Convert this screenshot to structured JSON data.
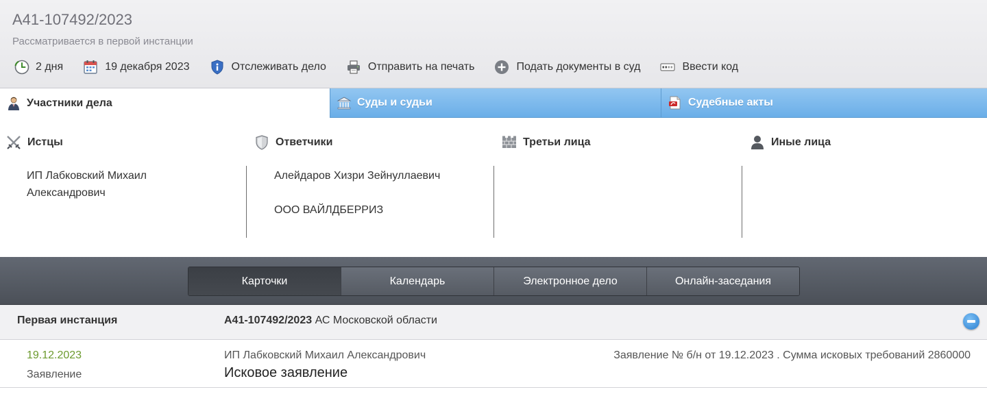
{
  "header": {
    "case_number": "А41-107492/2023",
    "status": "Рассматривается в первой инстанции",
    "actions": [
      {
        "label": "2 дня",
        "icon": "clock-icon"
      },
      {
        "label": "19 декабря 2023",
        "icon": "calendar-icon"
      },
      {
        "label": "Отслеживать дело",
        "icon": "shield-info-icon"
      },
      {
        "label": "Отправить на печать",
        "icon": "printer-icon"
      },
      {
        "label": "Подать документы в суд",
        "icon": "plus-circle-icon"
      },
      {
        "label": "Ввести код",
        "icon": "code-card-icon"
      }
    ]
  },
  "tabs": [
    {
      "label": "Участники дела",
      "icon": "person-icon",
      "active": true
    },
    {
      "label": "Суды и судьи",
      "icon": "courthouse-icon",
      "active": false
    },
    {
      "label": "Судебные акты",
      "icon": "pdf-document-icon",
      "active": false
    }
  ],
  "participants": {
    "plaintiffs": {
      "title": "Истцы",
      "icon": "crossed-swords-icon",
      "items": [
        "ИП Лабковский Михаил Александрович"
      ]
    },
    "defendants": {
      "title": "Ответчики",
      "icon": "shield-icon",
      "items": [
        "Алейдаров Хизри Зейнуллаевич",
        "ООО ВАЙЛДБЕРРИЗ"
      ]
    },
    "third_parties": {
      "title": "Третьи лица",
      "icon": "wall-icon",
      "items": []
    },
    "others": {
      "title": "Иные лица",
      "icon": "person-silhouette-icon",
      "items": []
    }
  },
  "nav": {
    "buttons": [
      "Карточки",
      "Календарь",
      "Электронное дело",
      "Онлайн-заседания"
    ],
    "active_index": 0
  },
  "instance": {
    "title": "Первая инстанция",
    "case_number": "А41-107492/2023",
    "court": "АС Московской области",
    "rows": [
      {
        "date": "19.12.2023",
        "type": "Заявление",
        "party": "ИП Лабковский Михаил Александрович",
        "document": "Исковое заявление",
        "description": "Заявление № б/н от 19.12.2023 . Сумма исковых требований 2860000"
      }
    ]
  },
  "colors": {
    "tab_blue": "#7ab8ec",
    "nav_dark": "#555a62",
    "date_green": "#6c9a2e",
    "collapse_blue": "#2b7fd0"
  }
}
